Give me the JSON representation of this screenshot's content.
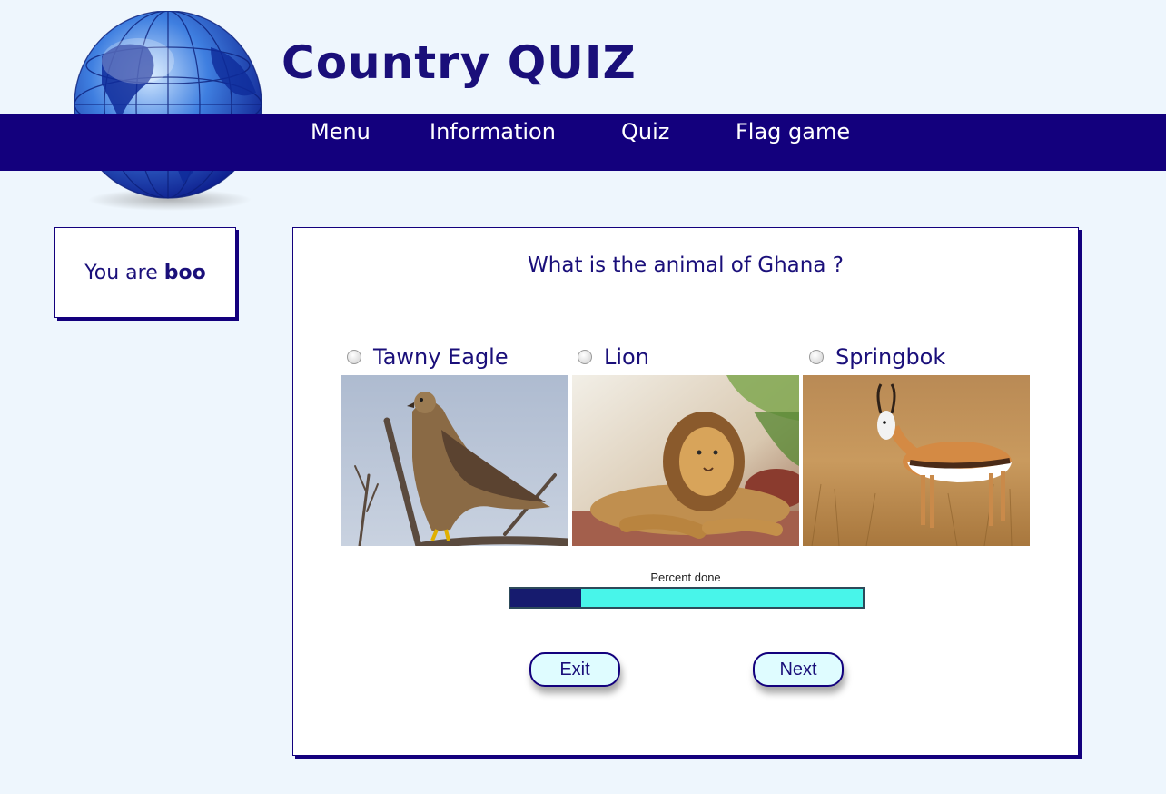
{
  "app": {
    "title": "Country QUIZ"
  },
  "nav": {
    "items": [
      {
        "label": "Menu"
      },
      {
        "label": "Information"
      },
      {
        "label": "Quiz"
      },
      {
        "label": "Flag game"
      }
    ]
  },
  "user": {
    "prefix": "You are",
    "name": "boo"
  },
  "quiz": {
    "question": "What is the animal of Ghana ?",
    "options": [
      {
        "label": "Tawny Eagle",
        "image": "tawny-eagle-photo",
        "selected": false
      },
      {
        "label": "Lion",
        "image": "lion-photo",
        "selected": false
      },
      {
        "label": "Springbok",
        "image": "springbok-photo",
        "selected": false
      }
    ],
    "progress": {
      "caption": "Percent done",
      "fraction": 0.2
    },
    "buttons": {
      "exit": "Exit",
      "next": "Next"
    }
  },
  "colors": {
    "navbar": "#13007d",
    "text": "#1a0f7a",
    "background": "#eef6fd",
    "progress_fill": "#161b6e",
    "progress_track": "#48f5ea"
  }
}
